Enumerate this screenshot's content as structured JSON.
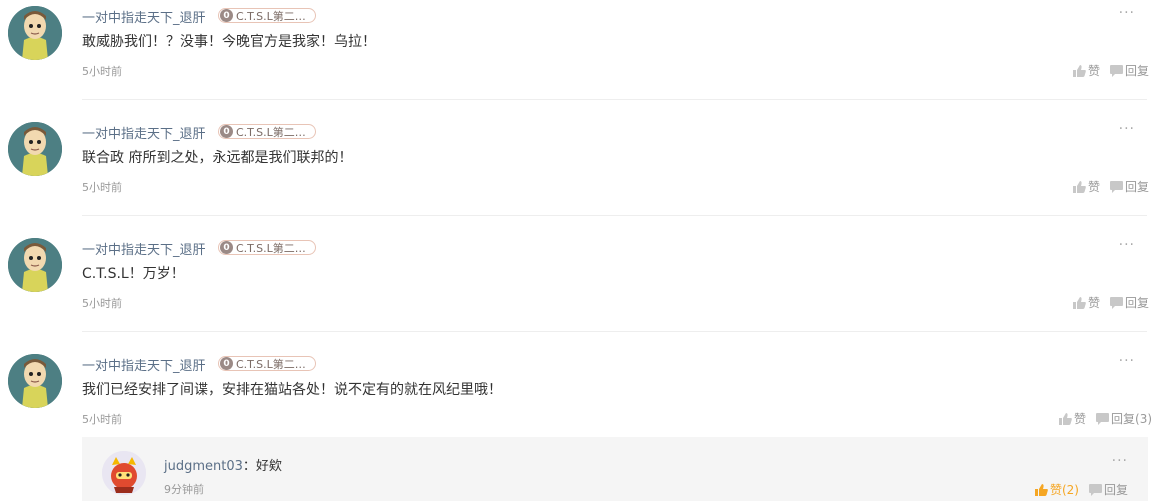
{
  "comments": [
    {
      "username": "一对中指走天下_退肝",
      "badge_level": "0",
      "badge_text": "C.T.S.L第二…",
      "text": "敢威胁我们！？没事！今晚官方是我家！乌拉！",
      "time": "5小时前",
      "like_label": "赞",
      "reply_label": "回复"
    },
    {
      "username": "一对中指走天下_退肝",
      "badge_level": "0",
      "badge_text": "C.T.S.L第二…",
      "text": "联合政 府所到之处，永远都是我们联邦的！",
      "time": "5小时前",
      "like_label": "赞",
      "reply_label": "回复"
    },
    {
      "username": "一对中指走天下_退肝",
      "badge_level": "0",
      "badge_text": "C.T.S.L第二…",
      "text": "C.T.S.L！万岁！",
      "time": "5小时前",
      "like_label": "赞",
      "reply_label": "回复"
    },
    {
      "username": "一对中指走天下_退肝",
      "badge_level": "0",
      "badge_text": "C.T.S.L第二…",
      "text": "我们已经安排了间谍，安排在猫站各处！说不定有的就在风纪里哦！",
      "time": "5小时前",
      "like_label": "赞",
      "reply_label": "回复(3)"
    }
  ],
  "reply": {
    "username": "judgment03",
    "separator": "：",
    "text": "好欸",
    "time": "9分钟前",
    "like_label": "赞(2)",
    "reply_label": "回复"
  },
  "more_label": "···",
  "colors": {
    "username": "#5b6f87",
    "liked": "#f5a623",
    "muted": "#999999"
  }
}
